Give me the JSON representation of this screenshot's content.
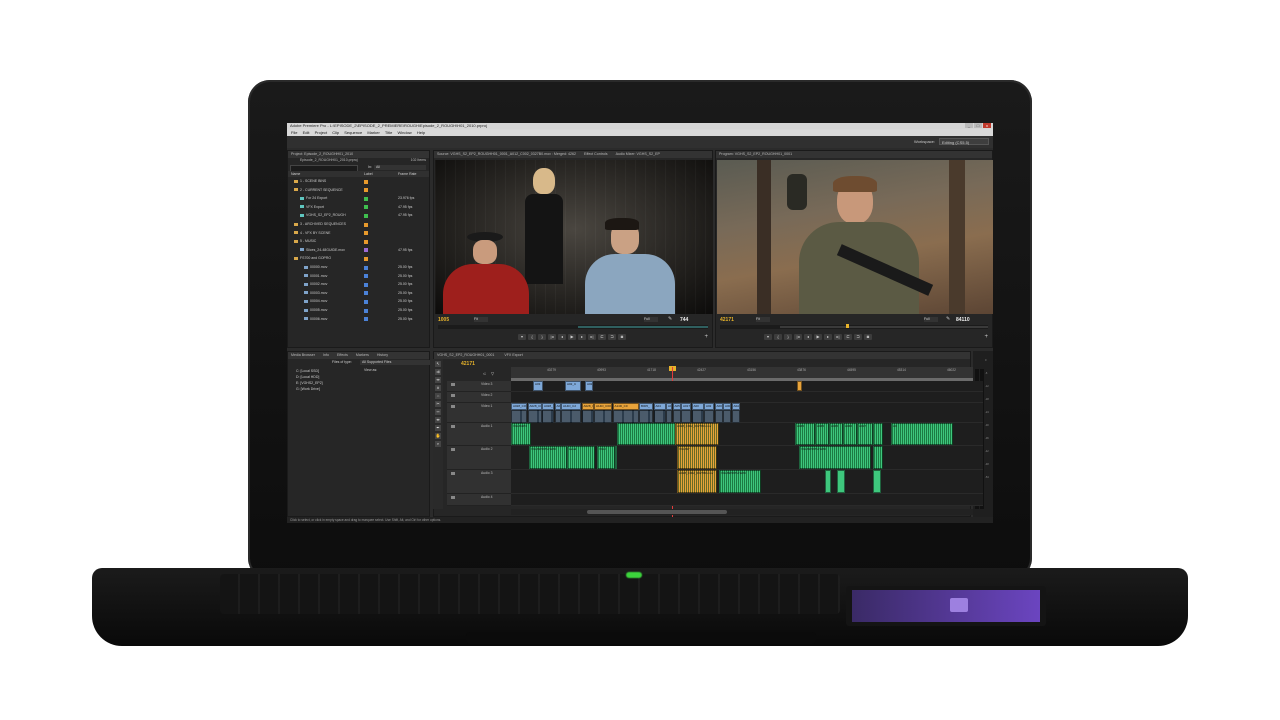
{
  "window": {
    "title": "Adobe Premiere Pro - L:\\EPISODE_2\\EPISODE_2_PREMIERE\\ROUGH\\Episode_2_ROUGH\\H01_2010.prproj",
    "min": "_",
    "max": "□",
    "close": "x"
  },
  "menu": [
    "File",
    "Edit",
    "Project",
    "Clip",
    "Sequence",
    "Marker",
    "Title",
    "Window",
    "Help"
  ],
  "workspace": {
    "label": "Workspace:",
    "value": "Editing (CS5.5)"
  },
  "project": {
    "tab": "Project: Episode_2_ROUGHH01_2010",
    "file": "Episode_2_ROUGHH01_2010.prproj",
    "count": "102 Items",
    "in_label": "In:",
    "in_value": "All",
    "columns": {
      "name": "Name",
      "label": "Label",
      "fps": "Frame Rate"
    },
    "items": [
      {
        "name": "1 - SCENE BINS",
        "type": "folder",
        "color": "#e89a2c",
        "fps": ""
      },
      {
        "name": "2 - CURRENT SEQUENCE",
        "type": "folder",
        "color": "#e89a2c",
        "fps": ""
      },
      {
        "name": "For 24 Export",
        "type": "seq",
        "color": "#3fbf4f",
        "fps": "23.976 fps"
      },
      {
        "name": "VFX Export",
        "type": "seq",
        "color": "#3fbf4f",
        "fps": "47.95 fps"
      },
      {
        "name": "VGHS_S2_EP2_ROUGH",
        "type": "seq",
        "color": "#3fbf4f",
        "fps": "47.95 fps"
      },
      {
        "name": "3 - ARCHIVED SEQUENCES",
        "type": "folder",
        "color": "#e89a2c",
        "fps": ""
      },
      {
        "name": "4 - VFX BY SCENE",
        "type": "folder",
        "color": "#e89a2c",
        "fps": ""
      },
      {
        "name": "5 - MUSIC",
        "type": "folder",
        "color": "#e89a2c",
        "fps": ""
      },
      {
        "name": "Slices_24-48GUIDE.mov",
        "type": "clip",
        "color": "#9c6bd6",
        "fps": "47.95 fps"
      },
      {
        "name": "FS700 and GOPRO",
        "type": "folder",
        "color": "#e89a2c",
        "fps": ""
      },
      {
        "name": "00000.mov",
        "type": "clip",
        "color": "#4b82d8",
        "fps": "25.00 fps"
      },
      {
        "name": "00001.mov",
        "type": "clip",
        "color": "#4b82d8",
        "fps": "25.00 fps"
      },
      {
        "name": "00002.mov",
        "type": "clip",
        "color": "#4b82d8",
        "fps": "25.00 fps"
      },
      {
        "name": "00003.mov",
        "type": "clip",
        "color": "#4b82d8",
        "fps": "25.00 fps"
      },
      {
        "name": "00004.mov",
        "type": "clip",
        "color": "#4b82d8",
        "fps": "25.00 fps"
      },
      {
        "name": "00005.mov",
        "type": "clip",
        "color": "#4b82d8",
        "fps": "25.00 fps"
      },
      {
        "name": "00006.mov",
        "type": "clip",
        "color": "#4b82d8",
        "fps": "25.00 fps"
      }
    ]
  },
  "media_browser": {
    "tabs": [
      "Media Browser",
      "Info",
      "Effects",
      "Markers",
      "History"
    ],
    "files_of_type_label": "Files of type:",
    "files_of_type_value": "All Supported Files",
    "view_as": "View as:",
    "drives": [
      "C: [Local SSD]",
      "D: [Local HDD]",
      "E: [VGHS2_EP2]",
      "G: [Work Drive]"
    ]
  },
  "source": {
    "tabs": [
      "Source: VGHS_S2_EP2_ROUGHH01_0001_A012_C002_0327B0.mov : Merged: 4262",
      "Effect Controls",
      "Audio Mixer: VGHS_S2_EP"
    ],
    "timecode": "1005",
    "fit": "Fit",
    "full": "Full",
    "duration": "744"
  },
  "program": {
    "tab": "Program: VGHS_S2_EP2_ROUGHH01_0001",
    "timecode": "42171",
    "fit": "Fit",
    "full": "Full",
    "duration": "84110"
  },
  "timeline": {
    "tabs": [
      "VGHS_S2_EP2_ROUGHH01_0001",
      "VFX Export"
    ],
    "timecode": "42171",
    "ruler": [
      "40279",
      "40993",
      "41718",
      "42427",
      "43156",
      "43876",
      "44595",
      "45314",
      "46022"
    ],
    "tracks": [
      {
        "name": "Video 3",
        "kind": "video"
      },
      {
        "name": "Video 2",
        "kind": "video"
      },
      {
        "name": "Video 1",
        "kind": "video"
      },
      {
        "name": "Audio 1",
        "kind": "audio"
      },
      {
        "name": "Audio 2",
        "kind": "audio"
      },
      {
        "name": "Audio 3",
        "kind": "audio"
      },
      {
        "name": "Audio 4",
        "kind": "audio"
      }
    ],
    "v3_clips": [
      "A03",
      "A02_C",
      "A02_C"
    ],
    "v1_clips": [
      "A028_C032",
      "A028_C032",
      "A028_",
      "A028_C010_0327",
      "A14D_C2",
      "A028_C002_0327BF.mov",
      "A14D_C003_0203VG A",
      "A14D_C0",
      "B005_",
      "A04",
      "A05",
      "A05",
      "A017",
      "A00",
      "A02",
      "A00",
      "A00",
      "A0A"
    ],
    "a1_clips": [
      "VGHS3P3",
      "A028_C002_0327BF.mov",
      "A045",
      "A045",
      "A045",
      "A046",
      "A017",
      "A0"
    ],
    "a2_clips": [
      "VGHSP26TH.WAV",
      "Level",
      "VGH",
      "VGHSP",
      "VGHSP26TH.WAV"
    ],
    "a3_clips": [
      "A028_C002_0327BF.mov",
      "VGHSP26TH.WAV"
    ]
  },
  "meters": [
    "0",
    "-6",
    "-12",
    "-18",
    "-24",
    "-30",
    "-36",
    "-42",
    "-48",
    "-54"
  ],
  "status": "Click to select, or click in empty space and drag to marquee select. Use Shift, Alt, and Ctrl for other options."
}
